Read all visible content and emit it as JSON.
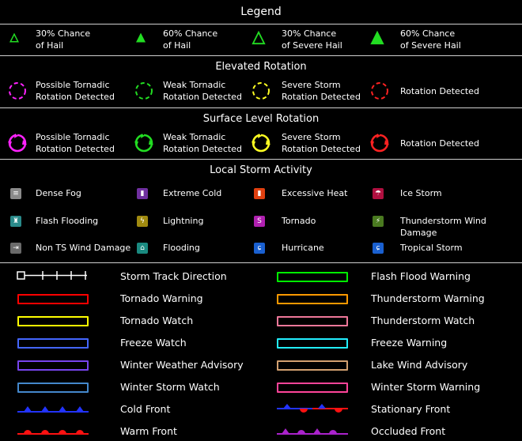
{
  "title": "Legend",
  "hail": [
    {
      "label": "30% Chance\nof Hail",
      "color": "#22dd22",
      "filled": false
    },
    {
      "label": "60% Chance\nof Hail",
      "color": "#22dd22",
      "filled": true
    },
    {
      "label": "30% Chance\nof Severe Hail",
      "color": "#22dd22",
      "filled": false
    },
    {
      "label": "60% Chance\nof Severe Hail",
      "color": "#22dd22",
      "filled": true
    }
  ],
  "elevated": {
    "title": "Elevated Rotation",
    "items": [
      {
        "label": "Possible Tornadic\nRotation Detected",
        "color": "#ff22ff"
      },
      {
        "label": "Weak Tornadic\nRotation Detected",
        "color": "#22dd22"
      },
      {
        "label": "Severe Storm\nRotation Detected",
        "color": "#ffff22"
      },
      {
        "label": "Rotation Detected",
        "color": "#ff2222"
      }
    ]
  },
  "surface": {
    "title": "Surface Level Rotation",
    "items": [
      {
        "label": "Possible Tornadic\nRotation Detected",
        "color": "#ff22ff"
      },
      {
        "label": "Weak Tornadic\nRotation Detected",
        "color": "#22dd22"
      },
      {
        "label": "Severe Storm\nRotation Detected",
        "color": "#ffff22"
      },
      {
        "label": "Rotation Detected",
        "color": "#ff2222"
      }
    ]
  },
  "storm": {
    "title": "Local Storm Activity",
    "items": [
      {
        "label": "Dense Fog",
        "icon": "fog-icon",
        "color": "#8a8a8a",
        "glyph": "≡"
      },
      {
        "label": "Extreme Cold",
        "icon": "thermometer-cold-icon",
        "color": "#7030a0",
        "glyph": "▮"
      },
      {
        "label": "Excessive Heat",
        "icon": "thermometer-heat-icon",
        "color": "#e04010",
        "glyph": "▮"
      },
      {
        "label": "Ice Storm",
        "icon": "ice-storm-icon",
        "color": "#b01040",
        "glyph": "☂"
      },
      {
        "label": "Flash Flooding",
        "icon": "flash-flood-icon",
        "color": "#2a8a8a",
        "glyph": "♜"
      },
      {
        "label": "Lightning",
        "icon": "lightning-icon",
        "color": "#a08a10",
        "glyph": "ϟ"
      },
      {
        "label": "Tornado",
        "icon": "tornado-icon",
        "color": "#b020b0",
        "glyph": "S"
      },
      {
        "label": "Thunderstorm Wind Damage",
        "icon": "wind-damage-icon",
        "color": "#4a7a20",
        "glyph": "⚡"
      },
      {
        "label": "Non TS Wind Damage",
        "icon": "wind-icon",
        "color": "#6a6a6a",
        "glyph": "⇥"
      },
      {
        "label": "Flooding",
        "icon": "flooding-icon",
        "color": "#1a8a80",
        "glyph": "⌂"
      },
      {
        "label": "Hurricane",
        "icon": "hurricane-icon",
        "color": "#1a60d0",
        "glyph": "ɕ"
      },
      {
        "label": "Tropical Storm",
        "icon": "tropical-storm-icon",
        "color": "#1a60d0",
        "glyph": "ɕ"
      }
    ]
  },
  "warnings_left": [
    {
      "label": "Storm Track Direction",
      "type": "track",
      "color": "#ffffff"
    },
    {
      "label": "Tornado Warning",
      "type": "box",
      "color": "#ff0000"
    },
    {
      "label": "Tornado Watch",
      "type": "box",
      "color": "#ffff00"
    },
    {
      "label": "Freeze Watch",
      "type": "box",
      "color": "#4466ff"
    },
    {
      "label": "Winter Weather Advisory",
      "type": "box",
      "color": "#7744ee"
    },
    {
      "label": "Winter Storm Watch",
      "type": "box",
      "color": "#4488cc"
    },
    {
      "label": "Cold Front",
      "type": "cold",
      "color": "#2233ff"
    },
    {
      "label": "Warm Front",
      "type": "warm",
      "color": "#ff1111"
    }
  ],
  "warnings_right": [
    {
      "label": "Flash Flood Warning",
      "type": "box",
      "color": "#00ee00"
    },
    {
      "label": "Thunderstorm Warning",
      "type": "box",
      "color": "#ff9900"
    },
    {
      "label": "Thunderstorm Watch",
      "type": "box",
      "color": "#ee7799"
    },
    {
      "label": "Freeze Warning",
      "type": "box",
      "color": "#22eeff"
    },
    {
      "label": "Lake Wind Advisory",
      "type": "box",
      "color": "#d2a070"
    },
    {
      "label": "Winter Storm Warning",
      "type": "box",
      "color": "#ff4499"
    },
    {
      "label": "Stationary Front",
      "type": "stationary",
      "color": "#ff1111",
      "color2": "#2233ff"
    },
    {
      "label": "Occluded Front",
      "type": "occluded",
      "color": "#aa22cc"
    }
  ]
}
